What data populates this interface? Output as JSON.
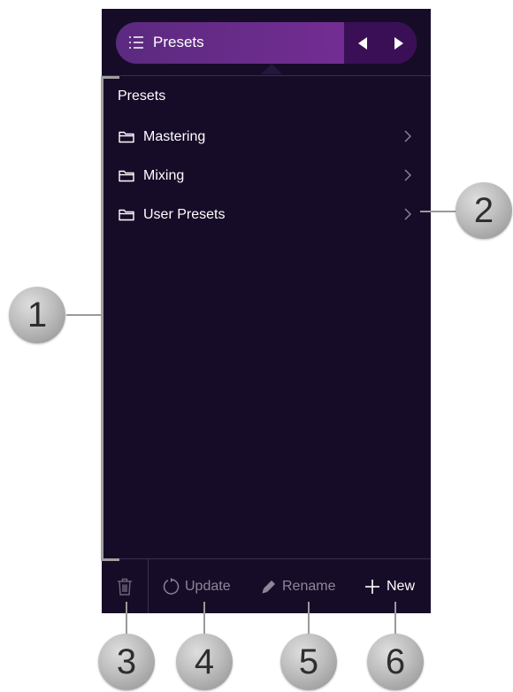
{
  "header": {
    "title": "Presets",
    "icons": {
      "menu": "list-icon",
      "prev": "triangle-left-icon",
      "next": "triangle-right-icon"
    }
  },
  "panel": {
    "title": "Presets",
    "items": [
      {
        "label": "Mastering",
        "icon": "folder-icon"
      },
      {
        "label": "Mixing",
        "icon": "folder-icon"
      },
      {
        "label": "User Presets",
        "icon": "folder-icon"
      }
    ]
  },
  "footer": {
    "delete_icon": "trash-icon",
    "update_label": "Update",
    "rename_label": "Rename",
    "new_label": "New"
  },
  "callouts": {
    "c1": "1",
    "c2": "2",
    "c3": "3",
    "c4": "4",
    "c5": "5",
    "c6": "6"
  },
  "colors": {
    "background": "#170c28",
    "pill_gradient_start": "#5b2a7f",
    "pill_gradient_end": "#7a2f99",
    "arrow_segment": "#3b0f55",
    "disabled_text": "#8d8799",
    "text": "#ffffff"
  }
}
